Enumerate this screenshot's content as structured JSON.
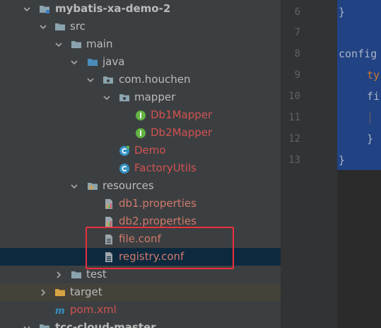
{
  "tree": {
    "rows": [
      {
        "label": "mybatis-xa-demo-2",
        "icon": "module-folder-icon",
        "arrow": "chevron-down-icon"
      },
      {
        "label": "src",
        "icon": "folder-icon",
        "arrow": "chevron-down-icon"
      },
      {
        "label": "main",
        "icon": "folder-icon",
        "arrow": "chevron-down-icon"
      },
      {
        "label": "java",
        "icon": "source-folder-icon",
        "arrow": "chevron-down-icon"
      },
      {
        "label": "com.houchen",
        "icon": "package-icon",
        "arrow": "chevron-down-icon"
      },
      {
        "label": "mapper",
        "icon": "package-icon",
        "arrow": "chevron-down-icon"
      },
      {
        "label": "Db1Mapper",
        "icon": "interface-icon"
      },
      {
        "label": "Db2Mapper",
        "icon": "interface-icon"
      },
      {
        "label": "Demo",
        "icon": "class-icon"
      },
      {
        "label": "FactoryUtils",
        "icon": "class-icon"
      },
      {
        "label": "resources",
        "icon": "resources-folder-icon",
        "arrow": "chevron-down-icon"
      },
      {
        "label": "db1.properties",
        "icon": "properties-file-icon"
      },
      {
        "label": "db2.properties",
        "icon": "properties-file-icon"
      },
      {
        "label": "file.conf",
        "icon": "text-file-icon"
      },
      {
        "label": "registry.conf",
        "icon": "text-file-icon"
      },
      {
        "label": "test",
        "icon": "folder-icon",
        "arrow": "chevron-right-icon"
      },
      {
        "label": "target",
        "icon": "excluded-folder-icon",
        "arrow": "chevron-right-icon"
      },
      {
        "label": "pom.xml",
        "icon": "maven-icon"
      },
      {
        "label": "tcc-cloud-master",
        "icon": "module-folder-icon",
        "arrow": "chevron-down-icon"
      }
    ]
  },
  "editor": {
    "line_numbers": [
      "6",
      "7",
      "8",
      "9",
      "10",
      "11",
      "12",
      "13"
    ],
    "lines": [
      "}",
      "",
      "config",
      "ty",
      "fi",
      "",
      "}",
      "}"
    ]
  },
  "colors": {
    "selection_highlight": "#0d293e",
    "annotation_border": "#e8303c",
    "error_text": "#d25252"
  }
}
